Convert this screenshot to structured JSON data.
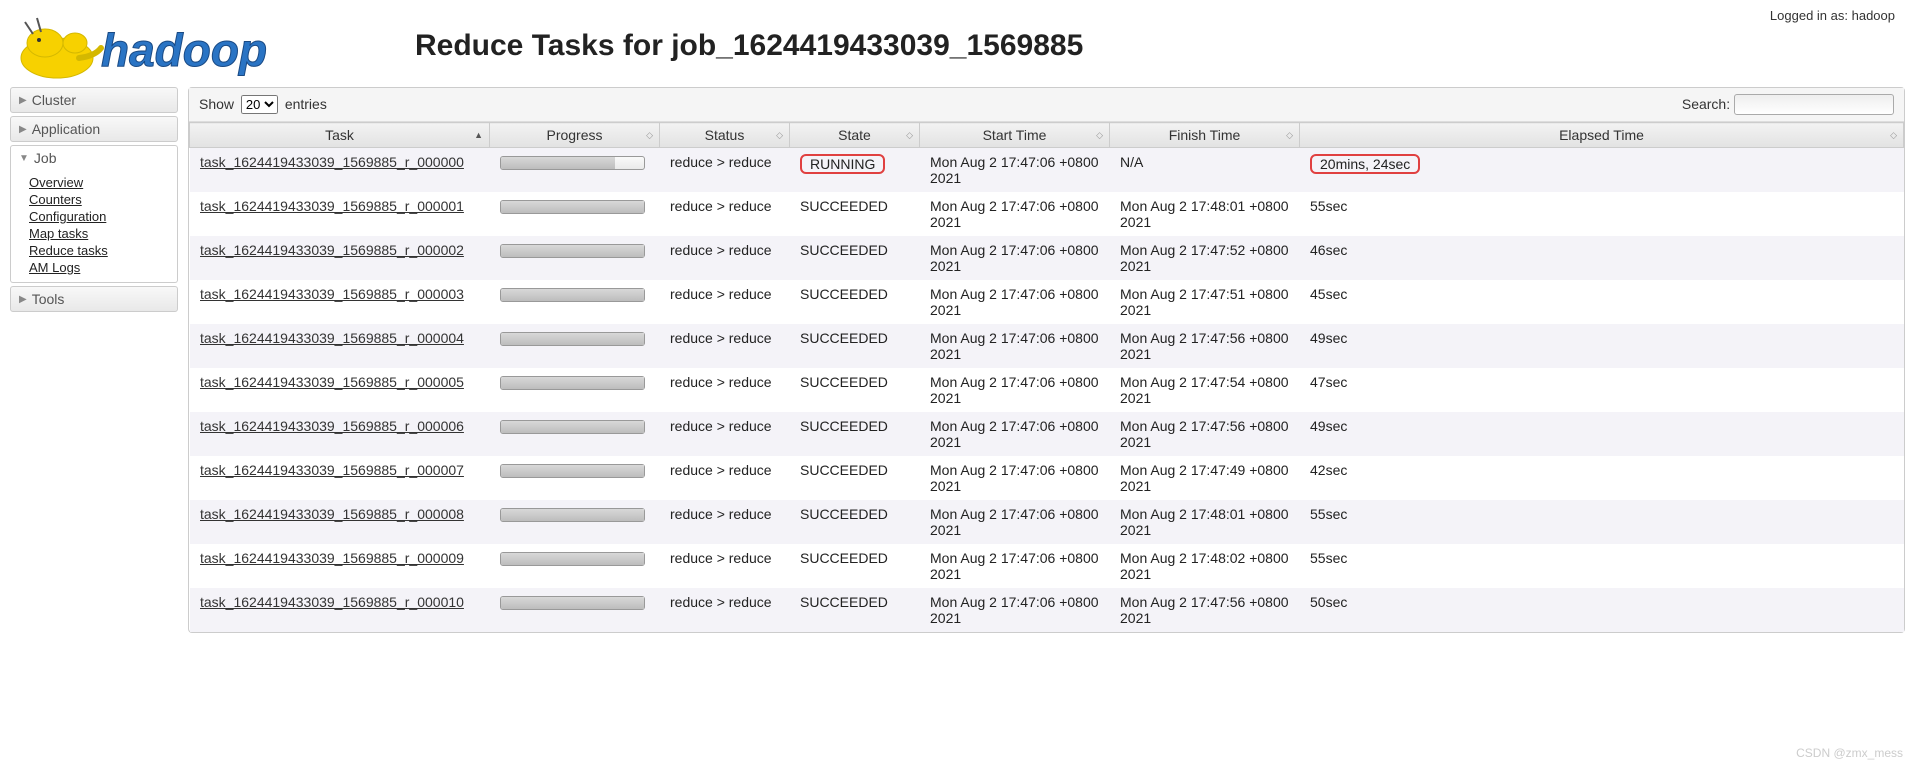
{
  "header": {
    "title": "Reduce Tasks for job_1624419433039_1569885",
    "logged_in_prefix": "Logged in as: ",
    "logged_in_user": "hadoop"
  },
  "nav": {
    "cluster": "Cluster",
    "application": "Application",
    "job": {
      "label": "Job",
      "items": [
        "Overview",
        "Counters",
        "Configuration",
        "Map tasks",
        "Reduce tasks",
        "AM Logs"
      ]
    },
    "tools": "Tools"
  },
  "controls": {
    "show_prefix": "Show",
    "show_suffix": "entries",
    "page_size": "20",
    "search_label": "Search:",
    "search_value": ""
  },
  "columns": [
    "Task",
    "Progress",
    "Status",
    "State",
    "Start Time",
    "Finish Time",
    "Elapsed Time"
  ],
  "rows": [
    {
      "task": "task_1624419433039_1569885_r_000000",
      "progress": 80,
      "status": "reduce > reduce",
      "state": "RUNNING",
      "start": "Mon Aug 2 17:47:06 +0800 2021",
      "finish": "N/A",
      "elapsed": "20mins, 24sec",
      "highlight": true
    },
    {
      "task": "task_1624419433039_1569885_r_000001",
      "progress": 100,
      "status": "reduce > reduce",
      "state": "SUCCEEDED",
      "start": "Mon Aug 2 17:47:06 +0800 2021",
      "finish": "Mon Aug 2 17:48:01 +0800 2021",
      "elapsed": "55sec"
    },
    {
      "task": "task_1624419433039_1569885_r_000002",
      "progress": 100,
      "status": "reduce > reduce",
      "state": "SUCCEEDED",
      "start": "Mon Aug 2 17:47:06 +0800 2021",
      "finish": "Mon Aug 2 17:47:52 +0800 2021",
      "elapsed": "46sec"
    },
    {
      "task": "task_1624419433039_1569885_r_000003",
      "progress": 100,
      "status": "reduce > reduce",
      "state": "SUCCEEDED",
      "start": "Mon Aug 2 17:47:06 +0800 2021",
      "finish": "Mon Aug 2 17:47:51 +0800 2021",
      "elapsed": "45sec"
    },
    {
      "task": "task_1624419433039_1569885_r_000004",
      "progress": 100,
      "status": "reduce > reduce",
      "state": "SUCCEEDED",
      "start": "Mon Aug 2 17:47:06 +0800 2021",
      "finish": "Mon Aug 2 17:47:56 +0800 2021",
      "elapsed": "49sec"
    },
    {
      "task": "task_1624419433039_1569885_r_000005",
      "progress": 100,
      "status": "reduce > reduce",
      "state": "SUCCEEDED",
      "start": "Mon Aug 2 17:47:06 +0800 2021",
      "finish": "Mon Aug 2 17:47:54 +0800 2021",
      "elapsed": "47sec"
    },
    {
      "task": "task_1624419433039_1569885_r_000006",
      "progress": 100,
      "status": "reduce > reduce",
      "state": "SUCCEEDED",
      "start": "Mon Aug 2 17:47:06 +0800 2021",
      "finish": "Mon Aug 2 17:47:56 +0800 2021",
      "elapsed": "49sec"
    },
    {
      "task": "task_1624419433039_1569885_r_000007",
      "progress": 100,
      "status": "reduce > reduce",
      "state": "SUCCEEDED",
      "start": "Mon Aug 2 17:47:06 +0800 2021",
      "finish": "Mon Aug 2 17:47:49 +0800 2021",
      "elapsed": "42sec"
    },
    {
      "task": "task_1624419433039_1569885_r_000008",
      "progress": 100,
      "status": "reduce > reduce",
      "state": "SUCCEEDED",
      "start": "Mon Aug 2 17:47:06 +0800 2021",
      "finish": "Mon Aug 2 17:48:01 +0800 2021",
      "elapsed": "55sec"
    },
    {
      "task": "task_1624419433039_1569885_r_000009",
      "progress": 100,
      "status": "reduce > reduce",
      "state": "SUCCEEDED",
      "start": "Mon Aug 2 17:47:06 +0800 2021",
      "finish": "Mon Aug 2 17:48:02 +0800 2021",
      "elapsed": "55sec"
    },
    {
      "task": "task_1624419433039_1569885_r_000010",
      "progress": 100,
      "status": "reduce > reduce",
      "state": "SUCCEEDED",
      "start": "Mon Aug 2 17:47:06 +0800 2021",
      "finish": "Mon Aug 2 17:47:56 +0800 2021",
      "elapsed": "50sec"
    }
  ],
  "watermark": "CSDN @zmx_mess"
}
